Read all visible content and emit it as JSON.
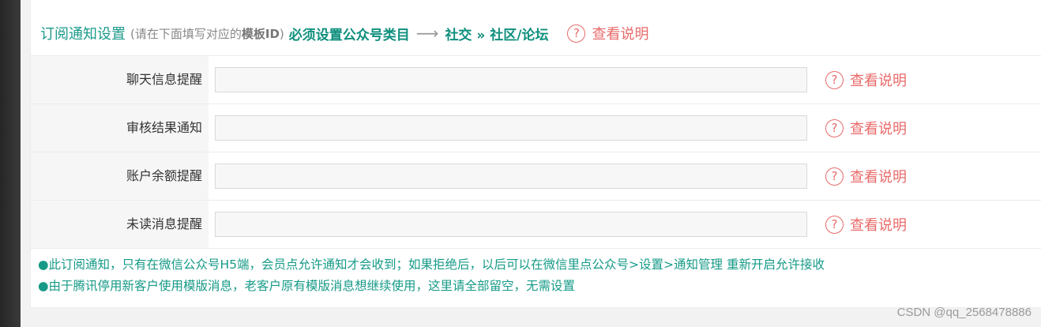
{
  "header": {
    "title": "订阅通知设置",
    "paren_prefix": "(请在下面填写对应的",
    "paren_bold": "模板ID",
    "paren_suffix": ")",
    "must": "必须设置公众号类目",
    "arrow": "⟶",
    "category": "社交 » 社区/论坛",
    "help_icon": "?",
    "help_label": "查看说明"
  },
  "rows": [
    {
      "label": "聊天信息提醒",
      "value": "",
      "help_label": "查看说明"
    },
    {
      "label": "审核结果通知",
      "value": "",
      "help_label": "查看说明"
    },
    {
      "label": "账户余额提醒",
      "value": "",
      "help_label": "查看说明"
    },
    {
      "label": "未读消息提醒",
      "value": "",
      "help_label": "查看说明"
    }
  ],
  "notes": [
    "●此订阅通知，只有在微信公众号H5端，会员点允许通知才会收到；如果拒绝后，以后可以在微信里点公众号>设置>通知管理 重新开启允许接收",
    "●由于腾讯停用新客户使用模版消息，老客户原有模版消息想继续使用，这里请全部留空，无需设置"
  ],
  "watermark": "CSDN @qq_2568478886",
  "colors": {
    "accent_teal": "#1a9a8a",
    "help_red": "#e86a6a"
  }
}
